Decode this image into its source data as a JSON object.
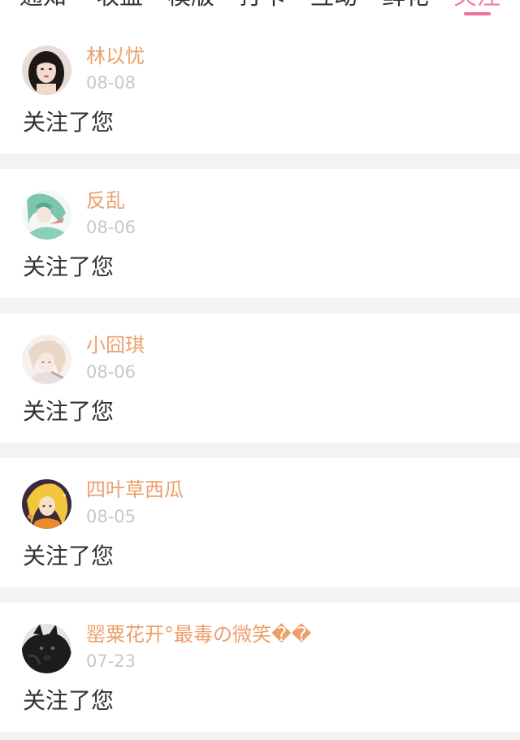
{
  "colors": {
    "accent": "#ef6f9c",
    "username": "#ec9f6a",
    "date": "#c8c8c8",
    "text": "#333333",
    "divider": "#f3f3f3"
  },
  "tabs": [
    {
      "label": "通知",
      "active": false
    },
    {
      "label": "收益",
      "active": false
    },
    {
      "label": "模版",
      "active": false
    },
    {
      "label": "打卡",
      "active": false
    },
    {
      "label": "互动",
      "active": false
    },
    {
      "label": "鲜花",
      "active": false
    },
    {
      "label": "关注",
      "active": true
    }
  ],
  "notifications": [
    {
      "username": "林以忧",
      "date": "08-08",
      "message": "关注了您",
      "avatar_icon": "avatar-girl-dark-hair"
    },
    {
      "username": "反乱",
      "date": "08-06",
      "message": "关注了您",
      "avatar_icon": "avatar-anime-green"
    },
    {
      "username": "小囧琪",
      "date": "08-06",
      "message": "关注了您",
      "avatar_icon": "avatar-anime-light"
    },
    {
      "username": "四叶草西瓜",
      "date": "08-05",
      "message": "关注了您",
      "avatar_icon": "avatar-anime-yellow"
    },
    {
      "username": "罂粟花开°最毒の微笑��",
      "date": "07-23",
      "message": "关注了您",
      "avatar_icon": "avatar-black-dog"
    }
  ]
}
